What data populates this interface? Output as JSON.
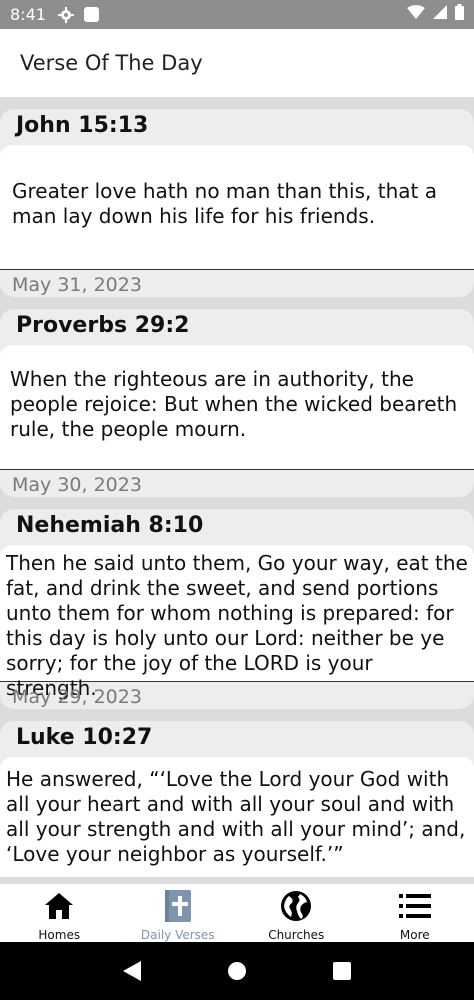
{
  "status_bar": {
    "time": "8:41",
    "icons": [
      "gear-icon",
      "square-icon",
      "wifi-icon",
      "signal-icon",
      "battery-icon"
    ]
  },
  "app_bar": {
    "title": "Verse Of The Day"
  },
  "verses": [
    {
      "reference": "John 15:13",
      "text": "Greater love hath no man than this, that a man lay down his life for his friends.",
      "date": "May 31, 2023"
    },
    {
      "reference": "Proverbs 29:2",
      "text": "When the righteous are in authority, the people rejoice: But when the wicked beareth rule, the people mourn.",
      "date": "May 30, 2023"
    },
    {
      "reference": "Nehemiah 8:10",
      "text": "Then he said unto them, Go your way, eat the fat, and drink the sweet, and send portions unto them for whom nothing is prepared: for this day is holy unto our Lord: neither be ye sorry; for the joy of the LORD is your strength.",
      "date": "May 29, 2023"
    },
    {
      "reference": "Luke 10:27",
      "text": "He answered, “‘Love the Lord your God with all your heart and with all your soul and with all your strength and with all your mind’; and, ‘Love your neighbor as yourself.’”",
      "date": ""
    }
  ],
  "bottom_nav": {
    "items": [
      {
        "label": "Homes",
        "icon": "home-icon"
      },
      {
        "label": "Daily Verses",
        "icon": "bible-icon",
        "active": true
      },
      {
        "label": "Churches",
        "icon": "globe-icon"
      },
      {
        "label": "More",
        "icon": "menu-icon"
      }
    ]
  },
  "colors": {
    "status_bar": "#8e8e8e",
    "feed_background": "#dcdcdc",
    "card_background": "#ededed",
    "active_nav": "#7f95ad"
  }
}
